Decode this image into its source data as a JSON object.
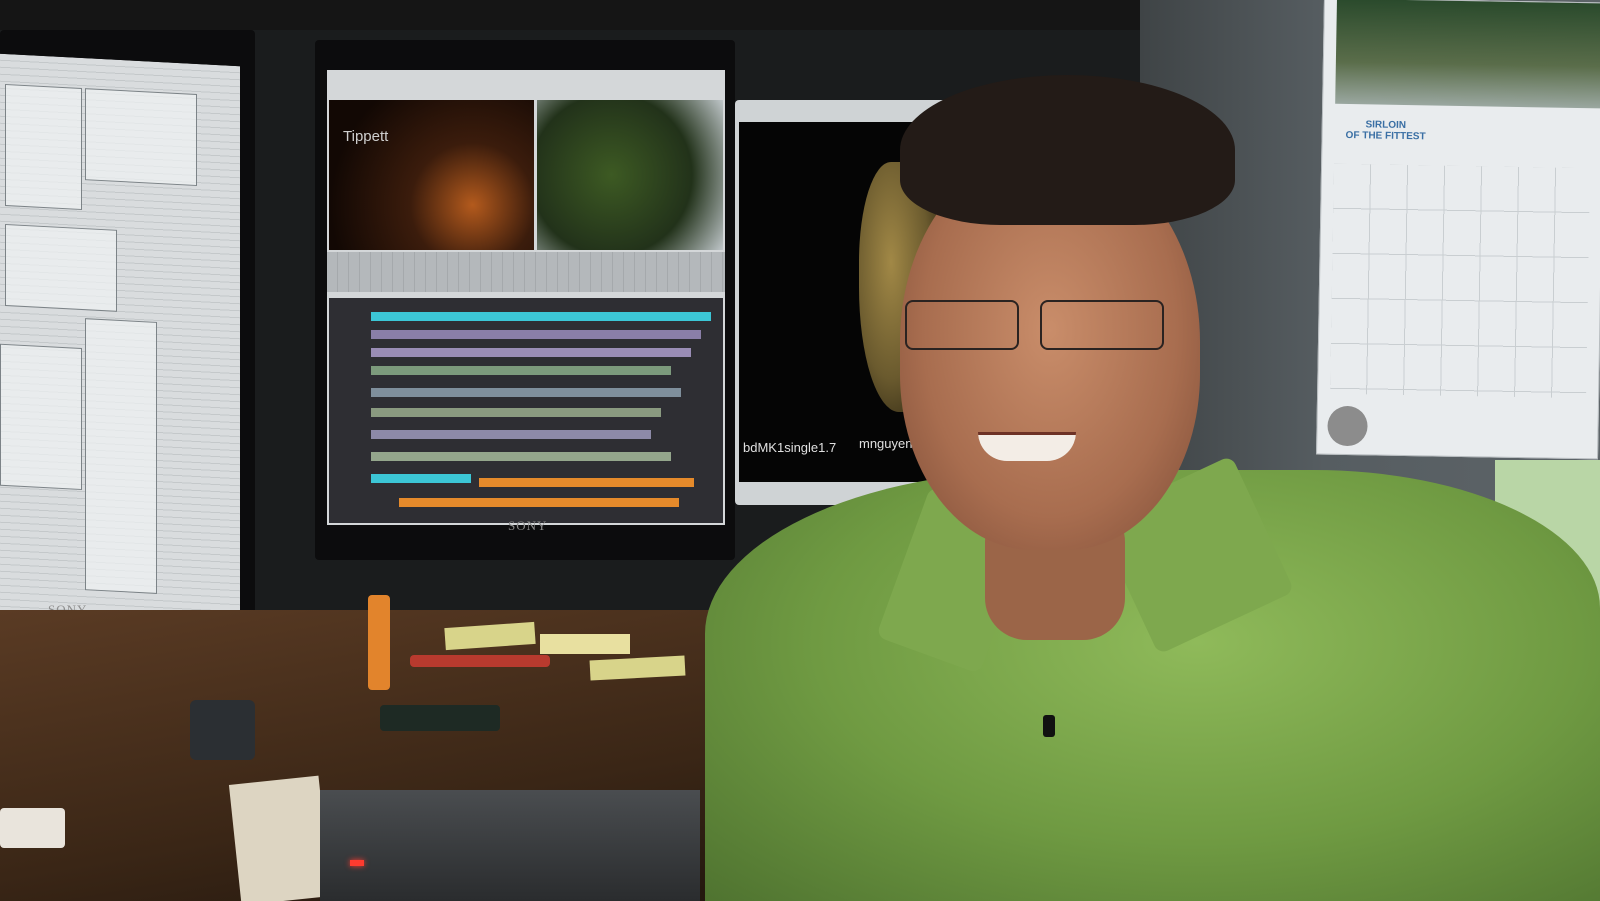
{
  "monitors": {
    "left_brand": "SONY",
    "center_brand": "SONY",
    "center_video_title": "Tippett",
    "right_caption_left": "bdMK1single1.7",
    "right_caption_right": "mnguyen"
  },
  "calendar": {
    "title_line1": "SIRLOIN",
    "title_line2": "OF THE FITTEST"
  },
  "colors": {
    "shirt": "#7ea84e",
    "wall": "#5d6468",
    "desk": "#4a311d",
    "timeline_orange": "#e58a2b",
    "timeline_cyan": "#3cc6d6"
  }
}
